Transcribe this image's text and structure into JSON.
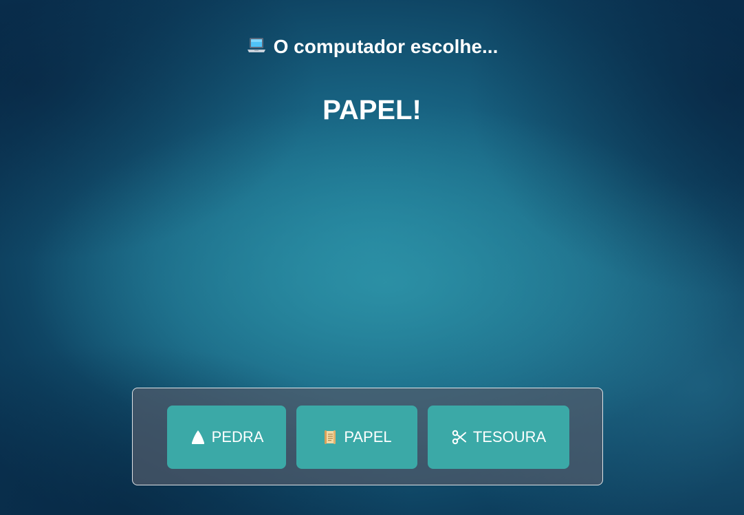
{
  "status": {
    "icon": "laptop-icon",
    "text": "O computador escolhe..."
  },
  "result": {
    "text": "PAPEL!"
  },
  "choices": [
    {
      "icon": "rock-icon",
      "label": "PEDRA"
    },
    {
      "icon": "scroll-icon",
      "label": "PAPEL"
    },
    {
      "icon": "scissors-icon",
      "label": "TESOURA"
    }
  ],
  "colors": {
    "button": "#3ba9a7",
    "panel": "#505a69",
    "text": "#ffffff"
  }
}
